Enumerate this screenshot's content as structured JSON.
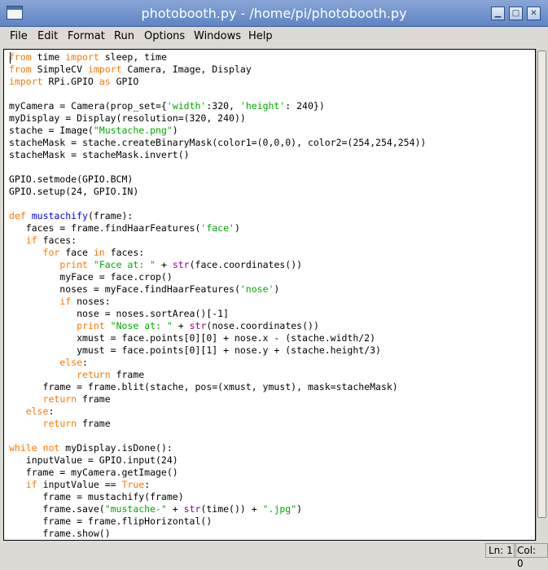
{
  "window": {
    "title": "photobooth.py - /home/pi/photobooth.py"
  },
  "menu": [
    "File",
    "Edit",
    "Format",
    "Run",
    "Options",
    "Windows",
    "Help"
  ],
  "colors": {
    "keyword": "#ff7700",
    "builtin": "#900090",
    "string": "#00aa00",
    "defname": "#0000ff",
    "text": "#000000"
  },
  "code_lines": [
    [
      [
        "keyword",
        "from"
      ],
      [
        "text",
        " time "
      ],
      [
        "keyword",
        "import"
      ],
      [
        "text",
        " sleep, time"
      ]
    ],
    [
      [
        "keyword",
        "from"
      ],
      [
        "text",
        " SimpleCV "
      ],
      [
        "keyword",
        "import"
      ],
      [
        "text",
        " Camera, Image, Display"
      ]
    ],
    [
      [
        "keyword",
        "import"
      ],
      [
        "text",
        " RPi.GPIO "
      ],
      [
        "keyword",
        "as"
      ],
      [
        "text",
        " GPIO"
      ]
    ],
    [],
    [
      [
        "text",
        "myCamera = Camera(prop_set={"
      ],
      [
        "string",
        "'width'"
      ],
      [
        "text",
        ":320, "
      ],
      [
        "string",
        "'height'"
      ],
      [
        "text",
        ": 240})"
      ]
    ],
    [
      [
        "text",
        "myDisplay = Display(resolution=(320, 240))"
      ]
    ],
    [
      [
        "text",
        "stache = Image("
      ],
      [
        "string",
        "\"Mustache.png\""
      ],
      [
        "text",
        ")"
      ]
    ],
    [
      [
        "text",
        "stacheMask = stache.createBinaryMask(color1=(0,0,0), color2=(254,254,254))"
      ]
    ],
    [
      [
        "text",
        "stacheMask = stacheMask.invert()"
      ]
    ],
    [],
    [
      [
        "text",
        "GPIO.setmode(GPIO.BCM)"
      ]
    ],
    [
      [
        "text",
        "GPIO.setup(24, GPIO.IN)"
      ]
    ],
    [],
    [
      [
        "keyword",
        "def"
      ],
      [
        "text",
        " "
      ],
      [
        "defname",
        "mustachify"
      ],
      [
        "text",
        "(frame):"
      ]
    ],
    [
      [
        "text",
        "   faces = frame.findHaarFeatures("
      ],
      [
        "string",
        "'face'"
      ],
      [
        "text",
        ")"
      ]
    ],
    [
      [
        "text",
        "   "
      ],
      [
        "keyword",
        "if"
      ],
      [
        "text",
        " faces:"
      ]
    ],
    [
      [
        "text",
        "      "
      ],
      [
        "keyword",
        "for"
      ],
      [
        "text",
        " face "
      ],
      [
        "keyword",
        "in"
      ],
      [
        "text",
        " faces:"
      ]
    ],
    [
      [
        "text",
        "         "
      ],
      [
        "keyword",
        "print"
      ],
      [
        "text",
        " "
      ],
      [
        "string",
        "\"Face at: \""
      ],
      [
        "text",
        " + "
      ],
      [
        "builtin",
        "str"
      ],
      [
        "text",
        "(face.coordinates())"
      ]
    ],
    [
      [
        "text",
        "         myFace = face.crop()"
      ]
    ],
    [
      [
        "text",
        "         noses = myFace.findHaarFeatures("
      ],
      [
        "string",
        "'nose'"
      ],
      [
        "text",
        ")"
      ]
    ],
    [
      [
        "text",
        "         "
      ],
      [
        "keyword",
        "if"
      ],
      [
        "text",
        " noses:"
      ]
    ],
    [
      [
        "text",
        "            nose = noses.sortArea()[-1]"
      ]
    ],
    [
      [
        "text",
        "            "
      ],
      [
        "keyword",
        "print"
      ],
      [
        "text",
        " "
      ],
      [
        "string",
        "\"Nose at: \""
      ],
      [
        "text",
        " + "
      ],
      [
        "builtin",
        "str"
      ],
      [
        "text",
        "(nose.coordinates())"
      ]
    ],
    [
      [
        "text",
        "            xmust = face.points[0][0] + nose.x - (stache.width/2)"
      ]
    ],
    [
      [
        "text",
        "            ymust = face.points[0][1] + nose.y + (stache.height/3)"
      ]
    ],
    [
      [
        "text",
        "         "
      ],
      [
        "keyword",
        "else"
      ],
      [
        "text",
        ":"
      ]
    ],
    [
      [
        "text",
        "            "
      ],
      [
        "keyword",
        "return"
      ],
      [
        "text",
        " frame"
      ]
    ],
    [
      [
        "text",
        "      frame = frame.blit(stache, pos=(xmust, ymust), mask=stacheMask)"
      ]
    ],
    [
      [
        "text",
        "      "
      ],
      [
        "keyword",
        "return"
      ],
      [
        "text",
        " frame"
      ]
    ],
    [
      [
        "text",
        "   "
      ],
      [
        "keyword",
        "else"
      ],
      [
        "text",
        ":"
      ]
    ],
    [
      [
        "text",
        "      "
      ],
      [
        "keyword",
        "return"
      ],
      [
        "text",
        " frame"
      ]
    ],
    [],
    [
      [
        "keyword",
        "while"
      ],
      [
        "text",
        " "
      ],
      [
        "keyword",
        "not"
      ],
      [
        "text",
        " myDisplay.isDone():"
      ]
    ],
    [
      [
        "text",
        "   inputValue = GPIO.input(24)"
      ]
    ],
    [
      [
        "text",
        "   frame = myCamera.getImage()"
      ]
    ],
    [
      [
        "text",
        "   "
      ],
      [
        "keyword",
        "if"
      ],
      [
        "text",
        " inputValue == "
      ],
      [
        "keyword",
        "True"
      ],
      [
        "text",
        ":"
      ]
    ],
    [
      [
        "text",
        "      frame = mustachify(frame)"
      ]
    ],
    [
      [
        "text",
        "      frame.save("
      ],
      [
        "string",
        "\"mustache-\""
      ],
      [
        "text",
        " + "
      ],
      [
        "builtin",
        "str"
      ],
      [
        "text",
        "(time()) + "
      ],
      [
        "string",
        "\".jpg\""
      ],
      [
        "text",
        ")"
      ]
    ],
    [
      [
        "text",
        "      frame = frame.flipHorizontal()"
      ]
    ],
    [
      [
        "text",
        "      frame.show()"
      ]
    ]
  ],
  "status": {
    "line": "Ln: 1",
    "col": "Col: 0"
  }
}
